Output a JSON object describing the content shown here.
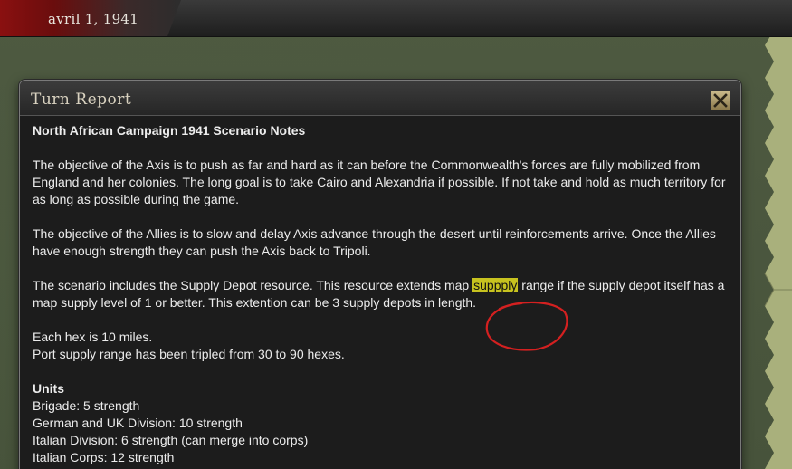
{
  "topbar": {
    "date": "avril 1, 1941"
  },
  "dialog": {
    "title": "Turn Report",
    "close_icon": "close-x-icon",
    "heading": "North African Campaign 1941 Scenario Notes",
    "para1": "The objective of the Axis is to push as far and hard as it can before the Commonwealth's forces are fully mobilized from England and her colonies. The long goal is to take Cairo and Alexandria if possible. If not take and hold as much territory for as long as possible during the game.",
    "para2": "The objective of the Allies is to slow and delay Axis advance through the desert until reinforcements arrive. Once the Allies have enough strength they can push the Axis back to Tripoli.",
    "para3_before": "The scenario includes the Supply Depot resource. This resource extends map ",
    "para3_highlight": "suppply",
    "para3_after": " range if the supply depot itself has a map supply level of 1 or better. This extention can be 3 supply depots in length.",
    "line_hex": "Each hex is 10 miles.",
    "line_port": "Port supply range has been tripled from 30 to 90 hexes.",
    "units_heading": "Units",
    "units": [
      "Brigade: 5 strength",
      "German and UK Division: 10 strength",
      "Italian Division: 6 strength (can merge into corps)",
      "Italian Corps: 12 strength"
    ]
  },
  "colors": {
    "highlight": "#c7c21f",
    "annotation_circle": "#d42020",
    "date_plate": "#8a1010"
  }
}
